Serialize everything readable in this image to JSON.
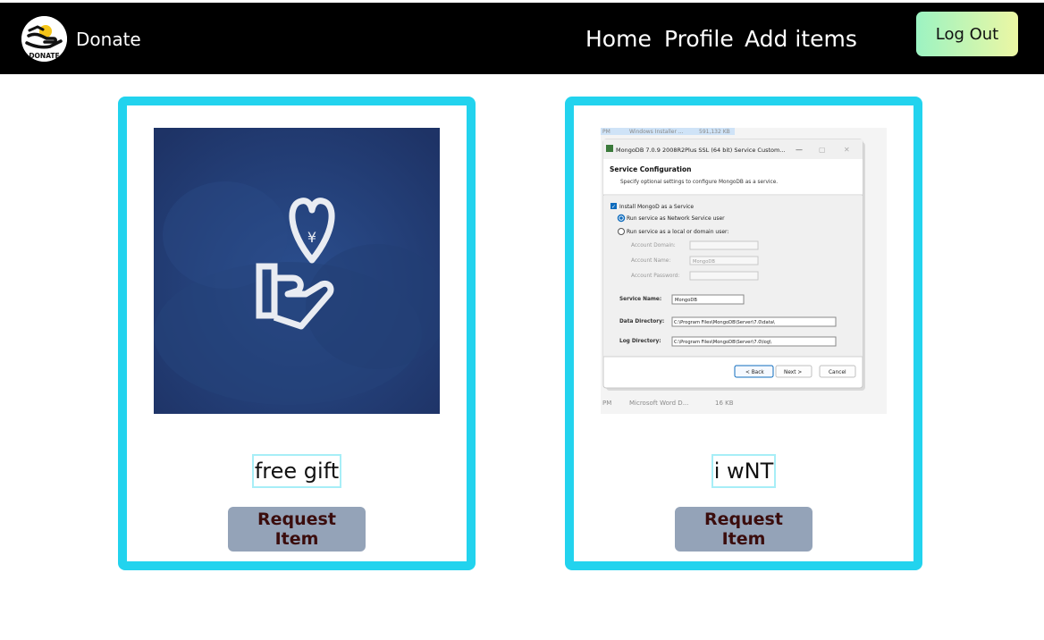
{
  "navbar": {
    "brand": "Donate",
    "logo_text": "DONATE",
    "links": [
      "Home",
      "Profile",
      "Add items"
    ],
    "logout_label": "Log Out"
  },
  "cards": [
    {
      "title": "free gift",
      "button_label": "Request Item",
      "image": "donate-hand-heart-illustration"
    },
    {
      "title": "i wNT",
      "button_label": "Request Item",
      "image": "mongodb-installer-screenshot",
      "screenshot": {
        "window_title": "MongoDB 7.0.9 2008R2Plus SSL (64 bit) Service Custom...",
        "heading": "Service Configuration",
        "subheading": "Specify optional settings to configure MongoDB as a service.",
        "install_checkbox": "Install MongoD as a Service",
        "radio_network": "Run service as Network Service user",
        "radio_local": "Run service as a local or domain user:",
        "account_domain_label": "Account Domain:",
        "account_name_label": "Account Name:",
        "account_name_value": "MongoDB",
        "account_password_label": "Account Password:",
        "service_name_label": "Service Name:",
        "service_name_value": "MongoDB",
        "data_dir_label": "Data Directory:",
        "data_dir_value": "C:\\Program Files\\MongoDB\\Server\\7.0\\data\\",
        "log_dir_label": "Log Directory:",
        "log_dir_value": "C:\\Program Files\\MongoDB\\Server\\7.0\\log\\",
        "back_label": "< Back",
        "next_label": "Next >",
        "cancel_label": "Cancel",
        "bg_top_time": "PM",
        "bg_top_name": "Windows Installer ...",
        "bg_top_size": "591,132 KB",
        "bg_bottom_time": "PM",
        "bg_bottom_name": "Microsoft Word D...",
        "bg_bottom_size": "16 KB"
      }
    }
  ],
  "colors": {
    "navbar_bg": "#000000",
    "card_border": "#22d3ee",
    "button_bg": "#94a3b8",
    "button_text": "#3b0d0d",
    "logout_gradient_start": "#9cf3c2",
    "logout_gradient_end": "#ecf7a4"
  }
}
